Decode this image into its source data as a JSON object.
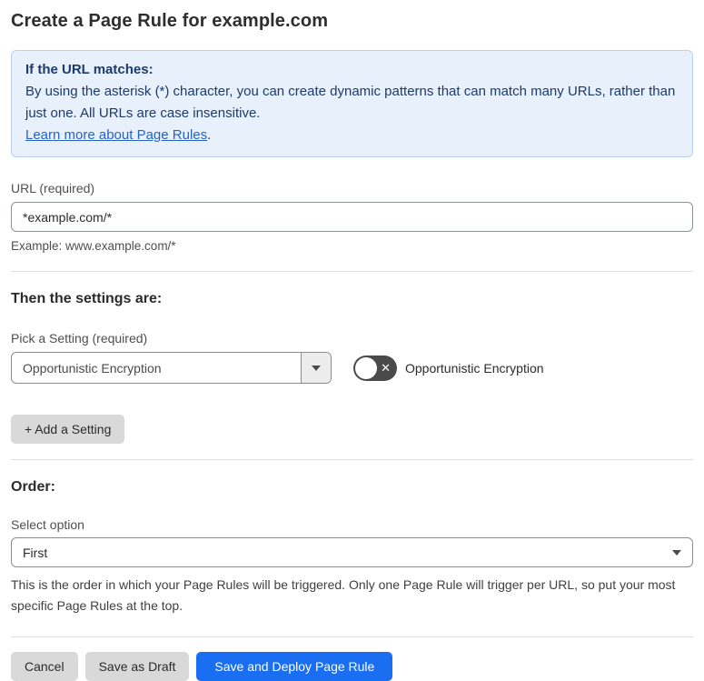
{
  "page": {
    "title": "Create a Page Rule for example.com"
  },
  "info_box": {
    "heading": "If the URL matches:",
    "body": "By using the asterisk (*) character, you can create dynamic patterns that can match many URLs, rather than just one. All URLs are case insensitive.",
    "link_label": "Learn more about Page Rules",
    "link_suffix": "."
  },
  "url_field": {
    "label": "URL (required)",
    "value": "*example.com/*",
    "example": "Example: www.example.com/*"
  },
  "settings": {
    "heading": "Then the settings are:",
    "picker_label": "Pick a Setting (required)",
    "selected_setting": "Opportunistic Encryption",
    "toggle": {
      "state": "off",
      "x_glyph": "✕",
      "label": "Opportunistic Encryption"
    },
    "add_button_label": "+ Add a Setting"
  },
  "order": {
    "heading": "Order:",
    "select_label": "Select option",
    "selected_option": "First",
    "help_text": "This is the order in which your Page Rules will be triggered. Only one Page Rule will trigger per URL, so put your most specific Page Rules at the top."
  },
  "footer": {
    "cancel_label": "Cancel",
    "save_draft_label": "Save as Draft",
    "save_deploy_label": "Save and Deploy Page Rule"
  },
  "colors": {
    "accent_blue": "#1a6ef2",
    "info_bg": "#e8f1fb",
    "info_border": "#b9d1ed",
    "info_text": "#1c3a6a",
    "link_blue": "#2862c4",
    "toggle_off_bg": "#4a4a4a",
    "button_gray": "#d9d9d9"
  }
}
